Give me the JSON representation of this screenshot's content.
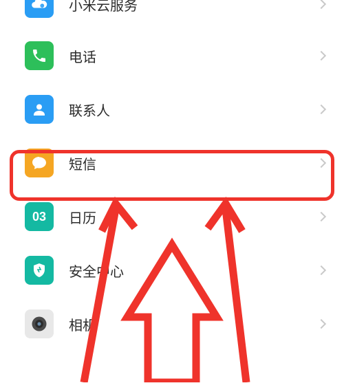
{
  "items": [
    {
      "key": "cloud",
      "label": "小米云服务"
    },
    {
      "key": "phone",
      "label": "电话"
    },
    {
      "key": "contact",
      "label": "联系人"
    },
    {
      "key": "sms",
      "label": "短信"
    },
    {
      "key": "cal",
      "label": "日历",
      "badge": "03"
    },
    {
      "key": "sec",
      "label": "安全中心"
    },
    {
      "key": "cam",
      "label": "相机"
    }
  ]
}
